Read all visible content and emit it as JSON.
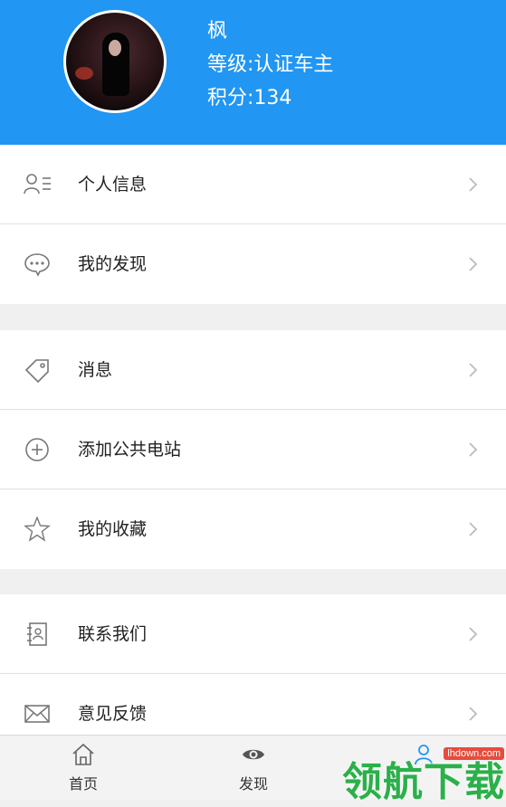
{
  "profile": {
    "name": "枫",
    "level": "等级:认证车主",
    "points": "积分:134"
  },
  "groups": [
    [
      {
        "label": "个人信息",
        "icon": "user-list-icon"
      },
      {
        "label": "我的发现",
        "icon": "chat-bubble-icon"
      }
    ],
    [
      {
        "label": "消息",
        "icon": "tag-icon"
      },
      {
        "label": "添加公共电站",
        "icon": "plus-circle-icon"
      },
      {
        "label": "我的收藏",
        "icon": "star-icon"
      }
    ],
    [
      {
        "label": "联系我们",
        "icon": "contact-card-icon"
      },
      {
        "label": "意见反馈",
        "icon": "envelope-icon"
      }
    ]
  ],
  "tabbar": {
    "home": "首页",
    "discover": "发现"
  },
  "watermark": {
    "text": "领航下载",
    "site": "lhdown.com"
  },
  "colors": {
    "header": "#2196f3",
    "watermark": "#2bb04a"
  }
}
